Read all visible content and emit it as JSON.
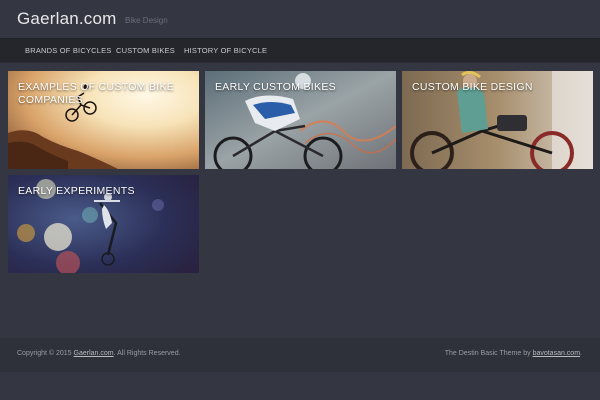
{
  "header": {
    "site_title": "Gaerlan.com",
    "tagline": "Bike Design"
  },
  "nav": {
    "items": [
      {
        "label": "BRANDS OF BICYCLES"
      },
      {
        "label": "CUSTOM BIKES"
      },
      {
        "label": "HISTORY OF BICYCLE"
      }
    ]
  },
  "posts": [
    {
      "title": "EXAMPLES OF CUSTOM BIKE COMPANIES"
    },
    {
      "title": "EARLY CUSTOM BIKES"
    },
    {
      "title": "CUSTOM BIKE DESIGN"
    },
    {
      "title": "EARLY EXPERIMENTS"
    }
  ],
  "footer": {
    "copyright_prefix": "Copyright © 2015 ",
    "copyright_link": "Gaerlan.com",
    "copyright_suffix": ". All Rights Reserved.",
    "credit_prefix": "The Destin Basic Theme by ",
    "credit_link": "bavotasan.com",
    "credit_suffix": "."
  },
  "colors": {
    "page_background": "#343741",
    "nav_background": "#24262c",
    "footer_background": "#2e3139"
  }
}
